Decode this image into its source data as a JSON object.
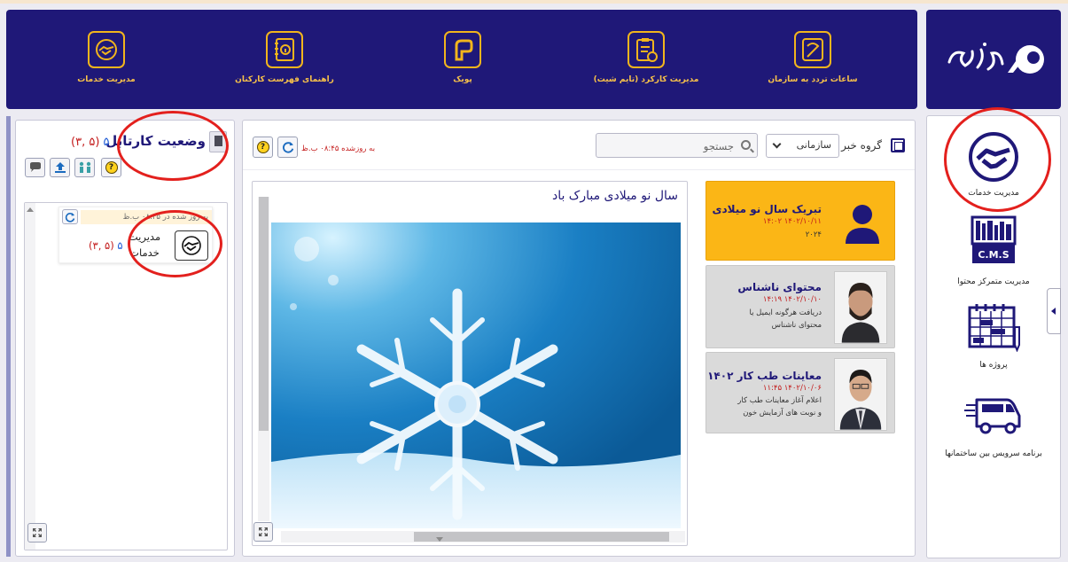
{
  "topbar": {
    "items": [
      {
        "label": "ساعات تردد به سازمان",
        "icon": "attendance-badge-icon"
      },
      {
        "label": "مدیریت کارکرد (تایم شیت)",
        "icon": "timesheet-clipboard-icon"
      },
      {
        "label": "پویک",
        "icon": "pouik-logo-icon"
      },
      {
        "label": "راهنمای فهرست کارکنان",
        "icon": "staff-directory-icon"
      },
      {
        "label": "مدیریت خدمات",
        "icon": "handshake-icon"
      }
    ],
    "logo_text": "نوران"
  },
  "cartable": {
    "title": "وضعیت کارتابل",
    "count_total": "۵",
    "count_detail": "(۵ ,۳)",
    "tools": [
      "help-icon",
      "users-icon",
      "upload-icon",
      "chat-icon"
    ],
    "service": {
      "name": "مدیریت خدمات",
      "update_text": "به روز شده در ۰۸:۴۵ ب.ظ",
      "count_total": "۵",
      "count_detail": "(۵ ,۳)"
    }
  },
  "news": {
    "group_label": "گروه خبر",
    "group_value": "سازمانی",
    "search_placeholder": "جستجو",
    "update_text": "به روزشده ۰۸:۴۵ ب.ظ",
    "detail_title": "سال نو میلادی مبارک باد",
    "items": [
      {
        "title": "تبریک سال نو میلادی",
        "date": "۱۴۰۲/۱۰/۱۱ ۱۴:۰۲",
        "desc": "۲۰۲۴"
      },
      {
        "title": "محتوای ناشناس",
        "date": "۱۴۰۲/۱۰/۱۰ ۱۴:۱۹",
        "desc": "دریافت هرگونه ایمیل یا محتوای ناشناس"
      },
      {
        "title": "معاینات طب کار ۱۴۰۲",
        "date": "۱۴۰۲/۱۰/۰۶ ۱۱:۴۵",
        "desc": "اعلام آغاز معاینات طب کار و نوبت های آزمایش خون"
      }
    ]
  },
  "sidebar": {
    "items": [
      {
        "label": "مدیریت خدمات",
        "icon": "handshake-icon"
      },
      {
        "label": "مدیریت متمرکز محتوا",
        "icon": "cms-icon",
        "badge": "C.M.S"
      },
      {
        "label": "پروژه ها",
        "icon": "project-calendar-icon"
      },
      {
        "label": "برنامه سرویس بین ساختمانها",
        "icon": "shuttle-van-icon"
      }
    ]
  },
  "colors": {
    "navy": "#1f1878",
    "gold": "#f2b51d",
    "active_news": "#fbb616",
    "annotation_red": "#e3201d"
  }
}
